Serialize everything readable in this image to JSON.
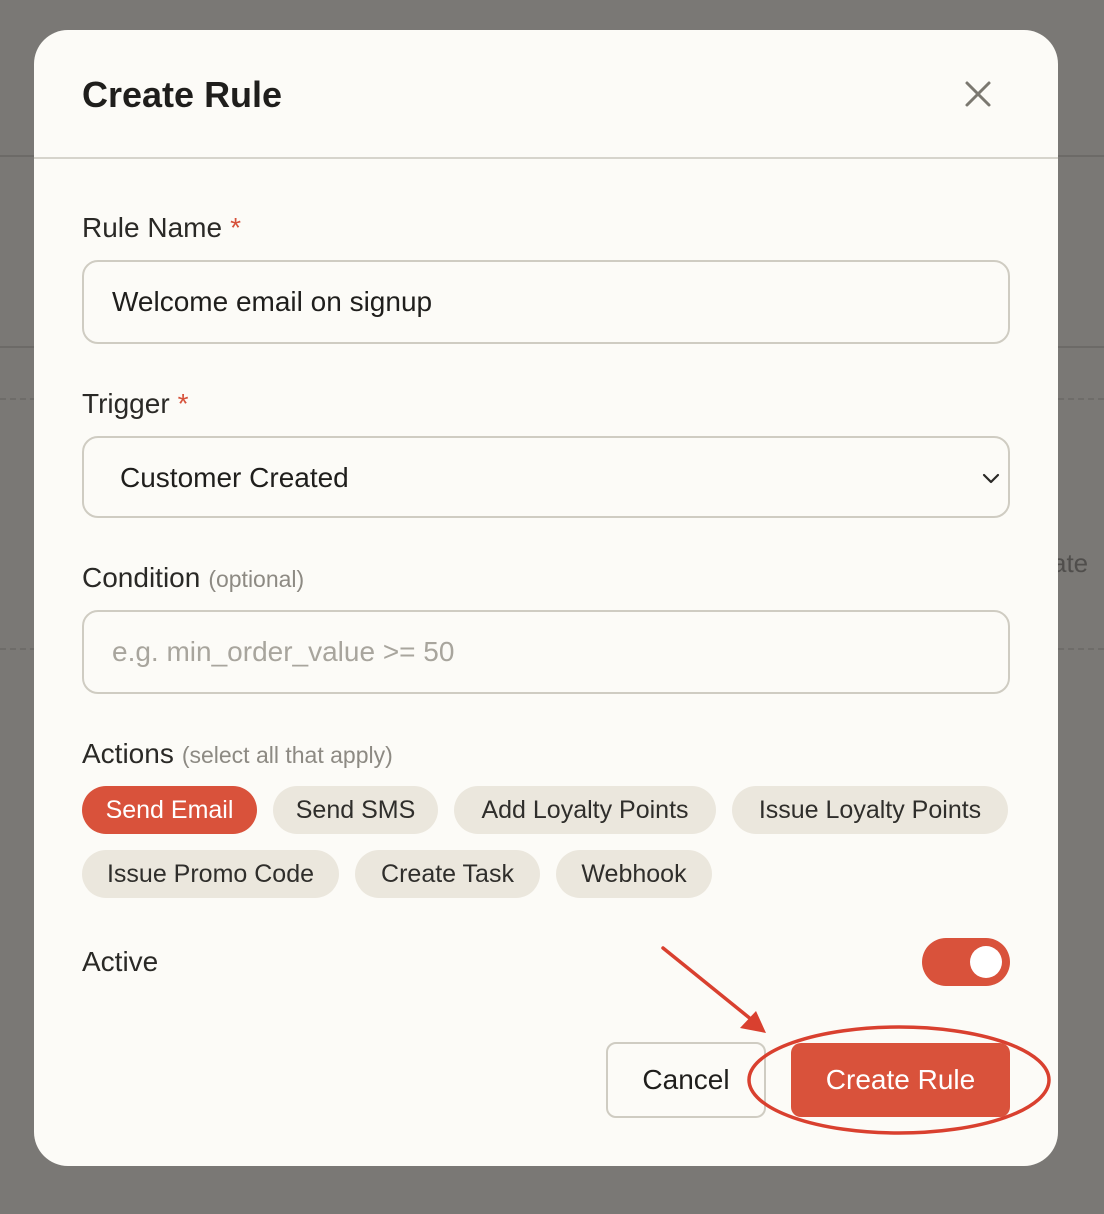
{
  "backdrop": {
    "partial_text": "ate"
  },
  "modal": {
    "title": "Create Rule",
    "close_icon": "close-icon"
  },
  "form": {
    "rule_name": {
      "label": "Rule Name",
      "required_mark": "*",
      "value": "Welcome email on signup"
    },
    "trigger": {
      "label": "Trigger",
      "required_mark": "*",
      "selected": "Customer Created",
      "icon": "chevron-down-icon"
    },
    "condition": {
      "label": "Condition",
      "hint": "(optional)",
      "value": "",
      "placeholder": "e.g. min_order_value >= 50"
    },
    "actions": {
      "label": "Actions",
      "hint": "(select all that apply)",
      "options": [
        {
          "label": "Send Email",
          "selected": true
        },
        {
          "label": "Send SMS",
          "selected": false
        },
        {
          "label": "Add Loyalty Points",
          "selected": false
        },
        {
          "label": "Issue Loyalty Points",
          "selected": false
        },
        {
          "label": "Issue Promo Code",
          "selected": false
        },
        {
          "label": "Create Task",
          "selected": false
        },
        {
          "label": "Webhook",
          "selected": false
        }
      ]
    },
    "active": {
      "label": "Active",
      "on": true
    }
  },
  "footer": {
    "cancel_label": "Cancel",
    "create_label": "Create Rule"
  },
  "colors": {
    "accent": "#d9523b",
    "modal_bg": "#fcfbf7",
    "chip_bg": "#ebe7dd",
    "border": "#cfccc2"
  }
}
